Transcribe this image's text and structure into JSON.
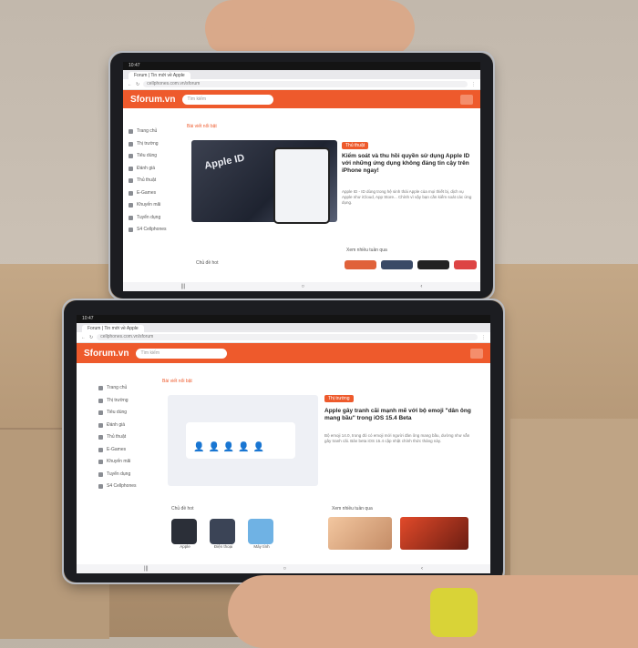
{
  "top": {
    "status_time": "10:47",
    "tab_label": "Forum | Tin mới về Apple",
    "url": "cellphones.com.vn/sforum",
    "logo": "Sforum.vn",
    "search_placeholder": "Tìm kiếm",
    "side_items": [
      "Trang chủ",
      "Thị trường",
      "Tiêu dùng",
      "Đánh giá",
      "Thủ thuật",
      "E-Games",
      "Khuyến mãi",
      "Tuyển dụng",
      "S4 Cellphones"
    ],
    "section": "Bài viết nổi bật",
    "badge": "Thủ thuật",
    "article_title": "Kiểm soát và thu hồi quyền sử dụng Apple ID với những ứng dụng không đáng tin cậy trên iPhone ngay!",
    "article_text": "Apple ID - ID dùng trong hệ sinh thái Apple của mọi thiết bị, dịch vụ Apple như iCloud, App Store... Chính vì vậy bạn cần kiểm soát các ứng dụng.",
    "chu_de": "Chủ đề hot",
    "xem_nhieu": "Xem nhiều tuần qua",
    "hero_text": "Apple ID"
  },
  "bottom": {
    "status_time": "10:47",
    "tab_label": "Forum | Tin mới về Apple",
    "url": "cellphones.com.vn/sforum",
    "logo": "Sforum.vn",
    "search_placeholder": "Tìm kiếm",
    "side_items": [
      "Trang chủ",
      "Thị trường",
      "Tiêu dùng",
      "Đánh giá",
      "Thủ thuật",
      "E-Games",
      "Khuyến mãi",
      "Tuyển dụng",
      "S4 Cellphones"
    ],
    "section": "Bài viết nổi bật",
    "badge": "Thị trường",
    "article_title": "Apple gây tranh cãi mạnh mẽ với bộ emoji \"dân ông mang bầu\" trong iOS 15.4 Beta",
    "article_text": "Bộ emoji 14.0, trong đó có emoji mới người đàn ông mang bầu, dường như vẫn gây tranh cãi. Bản beta iOS 15.4 cập nhật chính thức tháng này.",
    "chu_de": "Chủ đề hot",
    "xem_nhieu": "Xem nhiều tuần qua",
    "topics": [
      "Apple",
      "Điện thoại",
      "Máy tính"
    ]
  },
  "colors": {
    "accent": "#ee5a2c"
  }
}
